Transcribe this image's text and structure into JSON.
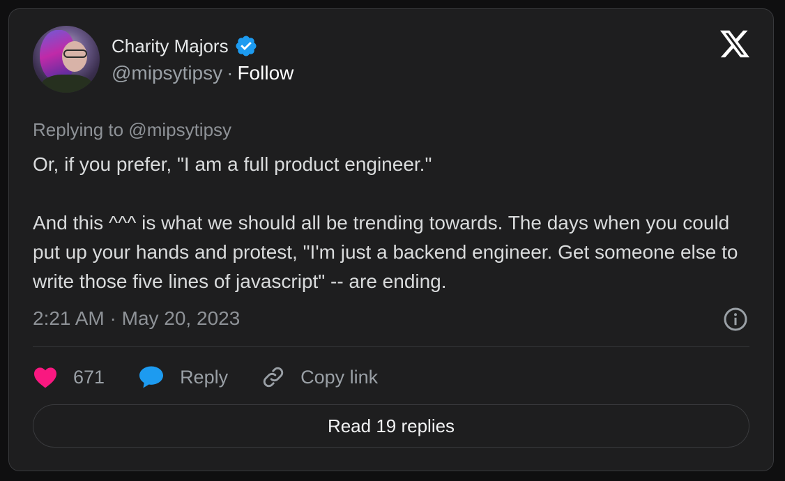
{
  "author": {
    "name": "Charity Majors",
    "handle": "@mipsytipsy",
    "separator": "·",
    "follow_label": "Follow"
  },
  "tweet": {
    "replying_to": "Replying to @mipsytipsy",
    "paragraphs": [
      "Or, if you prefer, \"I am a full product engineer.\"",
      "And this ^^^ is what we should all be trending towards. The days when you could put up your hands and protest, \"I'm just a backend engineer. Get someone else to write those five lines of javascript\" -- are ending."
    ],
    "timestamp": "2:21 AM · May 20, 2023"
  },
  "actions": {
    "like_count": "671",
    "reply_label": "Reply",
    "copy_link_label": "Copy link"
  },
  "read_replies_label": "Read 19 replies",
  "icons": {
    "brand": "x-logo-icon",
    "verified": "verified-badge-icon",
    "info": "info-icon",
    "like": "heart-icon",
    "reply": "speech-bubble-icon",
    "copy_link": "link-icon"
  },
  "colors": {
    "card_bg": "#1e1e1f",
    "verified": "#1d9bf0",
    "heart": "#f91880",
    "reply_bubble": "#1d9bf0",
    "muted_text": "#8e9297"
  }
}
